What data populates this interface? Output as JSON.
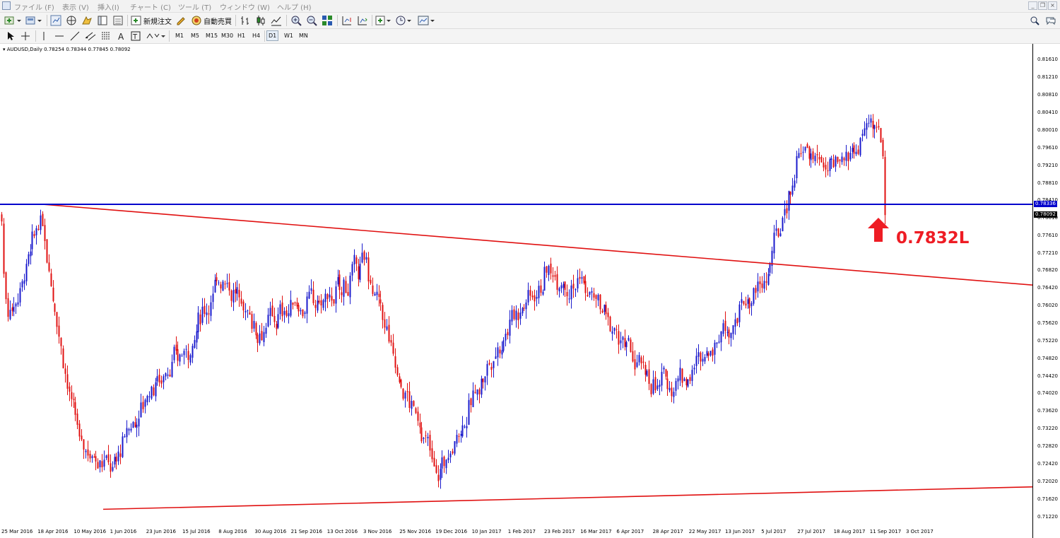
{
  "menu": {
    "items": [
      "ファイル (F)",
      "表示 (V)",
      "挿入(I)",
      "チャート (C)",
      "ツール (T)",
      "ウィンドウ (W)",
      "ヘルプ (H)"
    ]
  },
  "toolbar": {
    "new_order_label": "新規注文",
    "auto_trade_label": "自動売買",
    "timeframes": [
      "M1",
      "M5",
      "M15",
      "M30",
      "H1",
      "H4",
      "D1",
      "W1",
      "MN"
    ],
    "active_timeframe": "D1"
  },
  "chart": {
    "header": "AUDUSD,Daily  0.78254 0.78344 0.77845 0.78092",
    "y_ticks": [
      "0.81610",
      "0.81210",
      "0.80810",
      "0.80410",
      "0.80010",
      "0.79610",
      "0.79210",
      "0.78810",
      "0.78410",
      "0.78010",
      "0.77610",
      "0.77210",
      "0.76820",
      "0.76420",
      "0.76020",
      "0.75620",
      "0.75220",
      "0.74820",
      "0.74420",
      "0.74020",
      "0.73620",
      "0.73220",
      "0.72820",
      "0.72420",
      "0.72020",
      "0.71620",
      "0.71220"
    ],
    "x_ticks": [
      "25 Mar 2016",
      "18 Apr 2016",
      "10 May 2016",
      "1 Jun 2016",
      "23 Jun 2016",
      "15 Jul 2016",
      "8 Aug 2016",
      "30 Aug 2016",
      "21 Sep 2016",
      "13 Oct 2016",
      "3 Nov 2016",
      "25 Nov 2016",
      "19 Dec 2016",
      "10 Jan 2017",
      "1 Feb 2017",
      "23 Feb 2017",
      "16 Mar 2017",
      "6 Apr 2017",
      "28 Apr 2017",
      "22 May 2017",
      "13 Jun 2017",
      "5 Jul 2017",
      "27 Jul 2017",
      "18 Aug 2017",
      "11 Sep 2017",
      "3 Oct 2017"
    ],
    "horizontal_line_price": "0.78336",
    "last_price": "0.78092",
    "annotation": "0.7832L",
    "colors": {
      "bull": "#1a1acc",
      "bear": "#e01010",
      "hline": "#0000cc",
      "trend": "#e01010",
      "arrow": "#ee1c24"
    }
  },
  "chart_data": {
    "type": "candlestick",
    "symbol": "AUDUSD",
    "timeframe": "Daily",
    "ylim": [
      0.7102,
      0.8181
    ],
    "hline": 0.78336,
    "last_close": 0.78092,
    "anchors": [
      {
        "label": "25 Mar 2016",
        "price": 0.755
      },
      {
        "label": "18 Apr 2016",
        "price": 0.78
      },
      {
        "label": "10 May 2016",
        "price": 0.73
      },
      {
        "label": "1 Jun 2016",
        "price": 0.724
      },
      {
        "label": "23 Jun 2016",
        "price": 0.742
      },
      {
        "label": "15 Jul 2016",
        "price": 0.75
      },
      {
        "label": "8 Aug 2016",
        "price": 0.768
      },
      {
        "label": "30 Aug 2016",
        "price": 0.755
      },
      {
        "label": "21 Sep 2016",
        "price": 0.76
      },
      {
        "label": "13 Oct 2016",
        "price": 0.762
      },
      {
        "label": "3 Nov 2016",
        "price": 0.77
      },
      {
        "label": "25 Nov 2016",
        "price": 0.742
      },
      {
        "label": "19 Dec 2016",
        "price": 0.722
      },
      {
        "label": "10 Jan 2017",
        "price": 0.74
      },
      {
        "label": "1 Feb 2017",
        "price": 0.758
      },
      {
        "label": "23 Feb 2017",
        "price": 0.768
      },
      {
        "label": "16 Mar 2017",
        "price": 0.765
      },
      {
        "label": "6 Apr 2017",
        "price": 0.752
      },
      {
        "label": "28 Apr 2017",
        "price": 0.742
      },
      {
        "label": "22 May 2017",
        "price": 0.745
      },
      {
        "label": "13 Jun 2017",
        "price": 0.757
      },
      {
        "label": "5 Jul 2017",
        "price": 0.765
      },
      {
        "label": "27 Jul 2017",
        "price": 0.796
      },
      {
        "label": "18 Aug 2017",
        "price": 0.79
      },
      {
        "label": "11 Sep 2017",
        "price": 0.802
      },
      {
        "label": "3 Oct 2017",
        "price": 0.781
      }
    ],
    "trendlines": [
      {
        "name": "upper",
        "from": {
          "date": "18 Apr 2016",
          "price": 0.7834
        },
        "to": {
          "date": "end",
          "price": 0.765
        }
      },
      {
        "name": "lower",
        "from": {
          "date": "10 May 2016",
          "price": 0.714
        },
        "to": {
          "date": "end",
          "price": 0.7191
        }
      }
    ]
  }
}
